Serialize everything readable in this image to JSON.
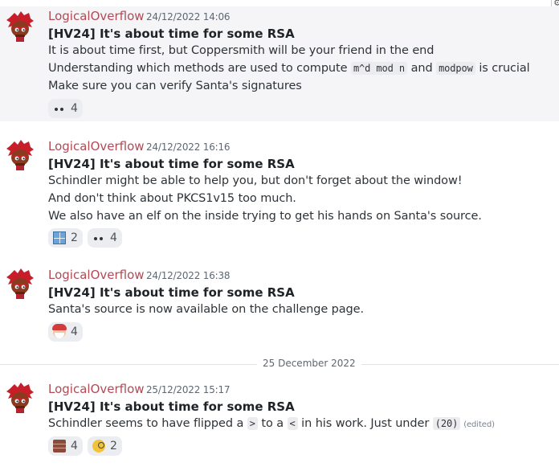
{
  "messages": [
    {
      "author": "LogicalOverflow",
      "timestamp": "24/12/2022 14:06",
      "title": "[HV24] It's about time for some RSA",
      "lines": [
        "It is about time first, but Coppersmith will be your friend in the end",
        {
          "pre": "Understanding which methods are used to compute ",
          "code1": "m^d mod n",
          "mid": " and ",
          "code2": "modpow",
          "post": " is crucial"
        },
        "Make sure you can verify Santa's signatures"
      ],
      "reactions": [
        {
          "icon": "eyes-icon",
          "count": "4"
        }
      ]
    },
    {
      "author": "LogicalOverflow",
      "timestamp": "24/12/2022 16:16",
      "title": "[HV24] It's about time for some RSA",
      "lines": [
        "Schindler might be able to help you, but don't forget about the window!",
        "And don't think about PKCS1v15 too much.",
        "We also have an elf on the inside trying to get his hands on Santa's source."
      ],
      "reactions": [
        {
          "icon": "window-icon",
          "count": "2"
        },
        {
          "icon": "eyes-icon",
          "count": "4"
        }
      ]
    },
    {
      "author": "LogicalOverflow",
      "timestamp": "24/12/2022 16:38",
      "title": "[HV24] It's about time for some RSA",
      "lines": [
        "Santa's source is now available on the challenge page."
      ],
      "reactions": [
        {
          "icon": "santa-icon",
          "count": "4"
        }
      ]
    },
    {
      "author": "LogicalOverflow",
      "timestamp": "25/12/2022 15:17",
      "title": "[HV24] It's about time for some RSA",
      "lines": [
        {
          "pre": "Schindler seems to have flipped a ",
          "code1": ">",
          "mid": " to a ",
          "code2": "<",
          "post": " in his work. Just under ",
          "code3": "(20)",
          "edited": "(edited)"
        }
      ],
      "reactions": [
        {
          "icon": "bricks-icon",
          "count": "4"
        },
        {
          "icon": "monocle-face-icon",
          "count": "2"
        }
      ]
    }
  ],
  "divider": "25 December 2022",
  "corner_glyph": "⚙"
}
